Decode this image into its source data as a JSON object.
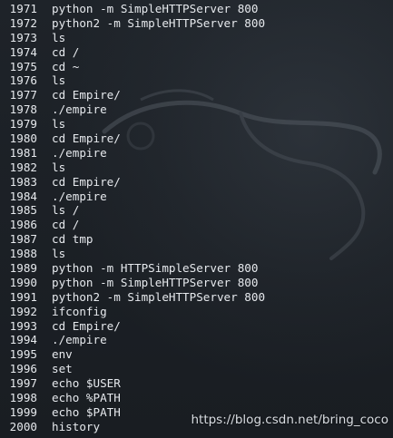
{
  "history": [
    {
      "num": "1971",
      "cmd": "python -m SimpleHTTPServer 800"
    },
    {
      "num": "1972",
      "cmd": "python2 -m SimpleHTTPServer 800"
    },
    {
      "num": "1973",
      "cmd": "ls"
    },
    {
      "num": "1974",
      "cmd": "cd /"
    },
    {
      "num": "1975",
      "cmd": "cd ~"
    },
    {
      "num": "1976",
      "cmd": "ls"
    },
    {
      "num": "1977",
      "cmd": "cd Empire/"
    },
    {
      "num": "1978",
      "cmd": "./empire"
    },
    {
      "num": "1979",
      "cmd": "ls"
    },
    {
      "num": "1980",
      "cmd": "cd Empire/"
    },
    {
      "num": "1981",
      "cmd": "./empire"
    },
    {
      "num": "1982",
      "cmd": "ls"
    },
    {
      "num": "1983",
      "cmd": "cd Empire/"
    },
    {
      "num": "1984",
      "cmd": "./empire"
    },
    {
      "num": "1985",
      "cmd": "ls /"
    },
    {
      "num": "1986",
      "cmd": "cd /"
    },
    {
      "num": "1987",
      "cmd": "cd tmp"
    },
    {
      "num": "1988",
      "cmd": "ls"
    },
    {
      "num": "1989",
      "cmd": "python -m HTTPSimpleServer 800"
    },
    {
      "num": "1990",
      "cmd": "python -m SimpleHTTPServer 800"
    },
    {
      "num": "1991",
      "cmd": "python2 -m SimpleHTTPServer 800"
    },
    {
      "num": "1992",
      "cmd": "ifconfig"
    },
    {
      "num": "1993",
      "cmd": "cd Empire/"
    },
    {
      "num": "1994",
      "cmd": "./empire"
    },
    {
      "num": "1995",
      "cmd": "env"
    },
    {
      "num": "1996",
      "cmd": "set"
    },
    {
      "num": "1997",
      "cmd": "echo $USER"
    },
    {
      "num": "1998",
      "cmd": "echo %PATH"
    },
    {
      "num": "1999",
      "cmd": "echo $PATH"
    },
    {
      "num": "2000",
      "cmd": "history"
    }
  ],
  "watermark": "https://blog.csdn.net/bring_coco",
  "colors": {
    "background": "#1b1f24",
    "text": "#e6e9ed",
    "watermark": "#d9dde2"
  },
  "background_icon": "kali-dragon-logo"
}
